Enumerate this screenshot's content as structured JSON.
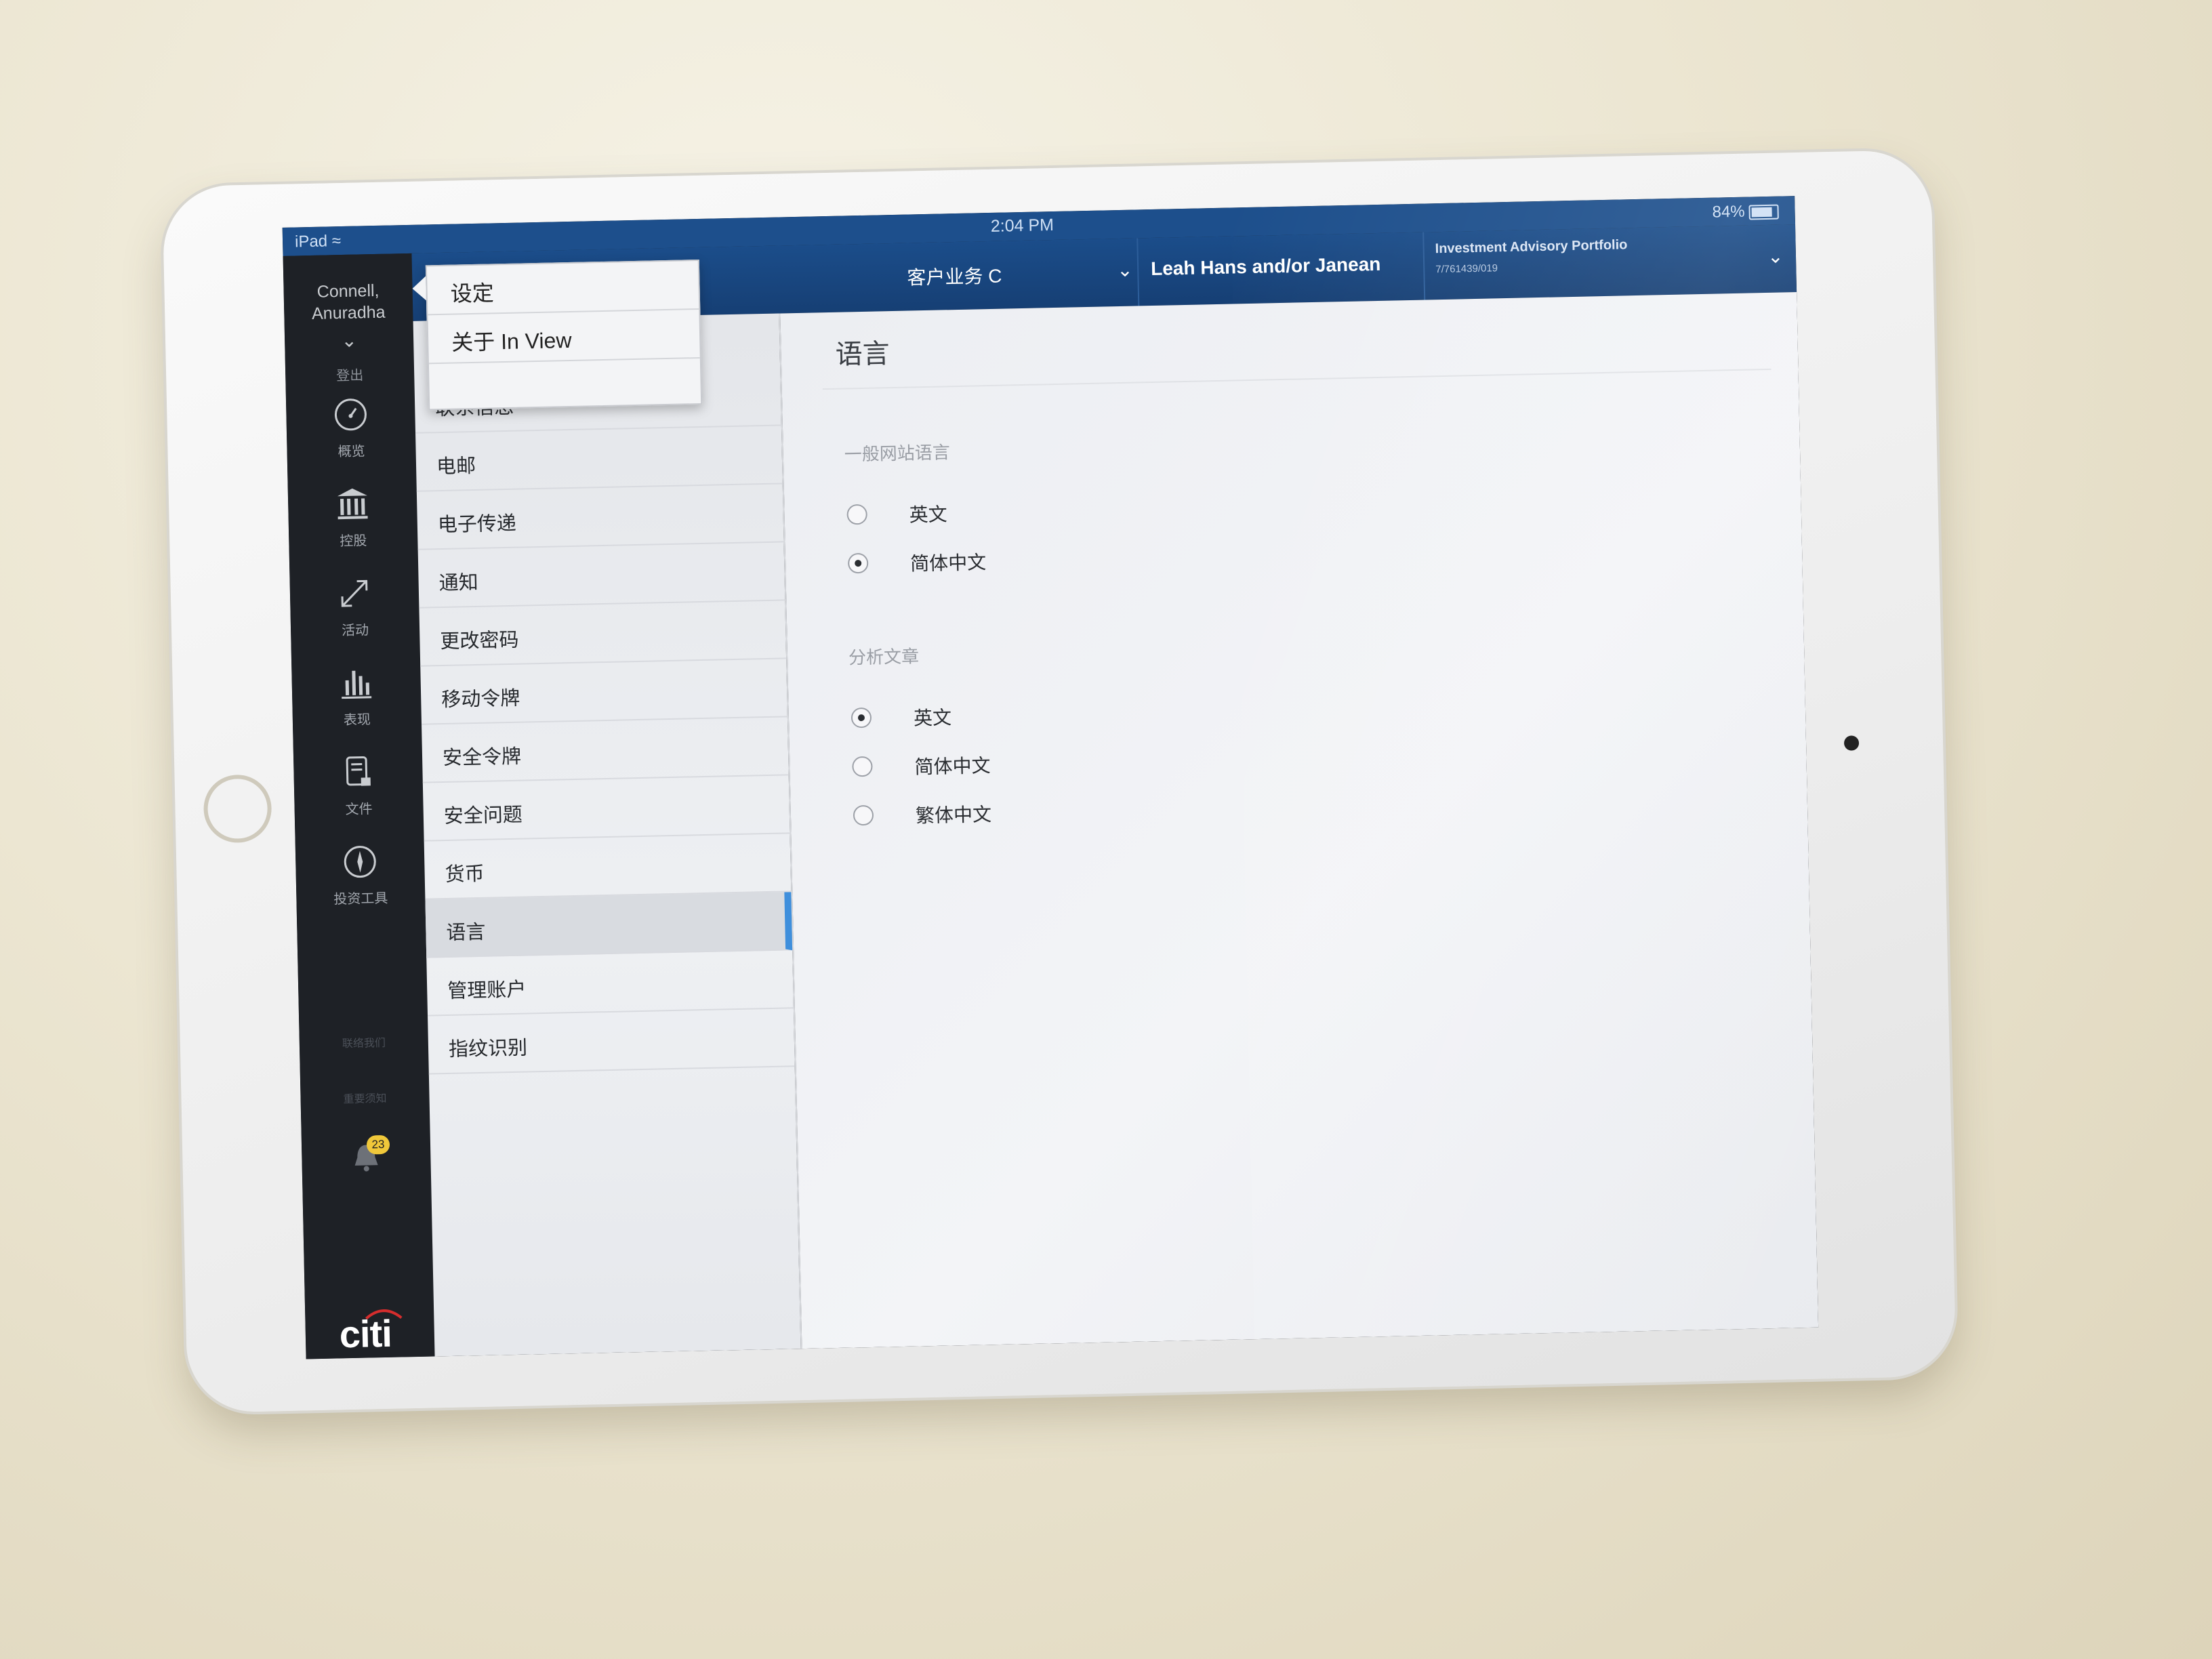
{
  "status_bar": {
    "carrier": "iPad",
    "time": "2:04 PM",
    "battery": "84%"
  },
  "header": {
    "client_select": "客户业务 C",
    "account_holder": "Leah  Hans and/or Janean",
    "portfolio_name": "Investment Advisory Portfolio",
    "portfolio_number": "7/761439/019"
  },
  "left_nav": {
    "user_name_line1": "Connell,",
    "user_name_line2": "Anuradha",
    "logout": "登出",
    "items": [
      {
        "label": "概览",
        "icon": "gauge-icon"
      },
      {
        "label": "控股",
        "icon": "bank-icon"
      },
      {
        "label": "活动",
        "icon": "arrows-expand-icon"
      },
      {
        "label": "表现",
        "icon": "bar-chart-icon"
      },
      {
        "label": "文件",
        "icon": "document-lock-icon"
      },
      {
        "label": "投资工具",
        "icon": "compass-icon"
      }
    ],
    "contact_us": "联络我们",
    "important_notice": "重要须知",
    "notification_count": "23",
    "logo": "citi"
  },
  "popup_menu": {
    "items": [
      "设定",
      "关于 In View"
    ]
  },
  "settings_list": {
    "items": [
      "联系信息",
      "电邮",
      "电子传递",
      "通知",
      "更改密码",
      "移动令牌",
      "安全令牌",
      "安全问题",
      "货币",
      "语言",
      "管理账户",
      "指纹识别"
    ],
    "selected": "语言"
  },
  "content": {
    "title": "语言",
    "general_section": {
      "label": "一般网站语言",
      "options": [
        "英文",
        "简体中文"
      ],
      "selected": "简体中文"
    },
    "analysis_section": {
      "label": "分析文章",
      "options": [
        "英文",
        "简体中文",
        "繁体中文"
      ],
      "selected": "英文"
    }
  },
  "colors": {
    "header_blue": "#1b4d8a",
    "nav_dark": "#1e2126",
    "selection_accent": "#3f8fdc",
    "badge_yellow": "#f0c83a"
  }
}
